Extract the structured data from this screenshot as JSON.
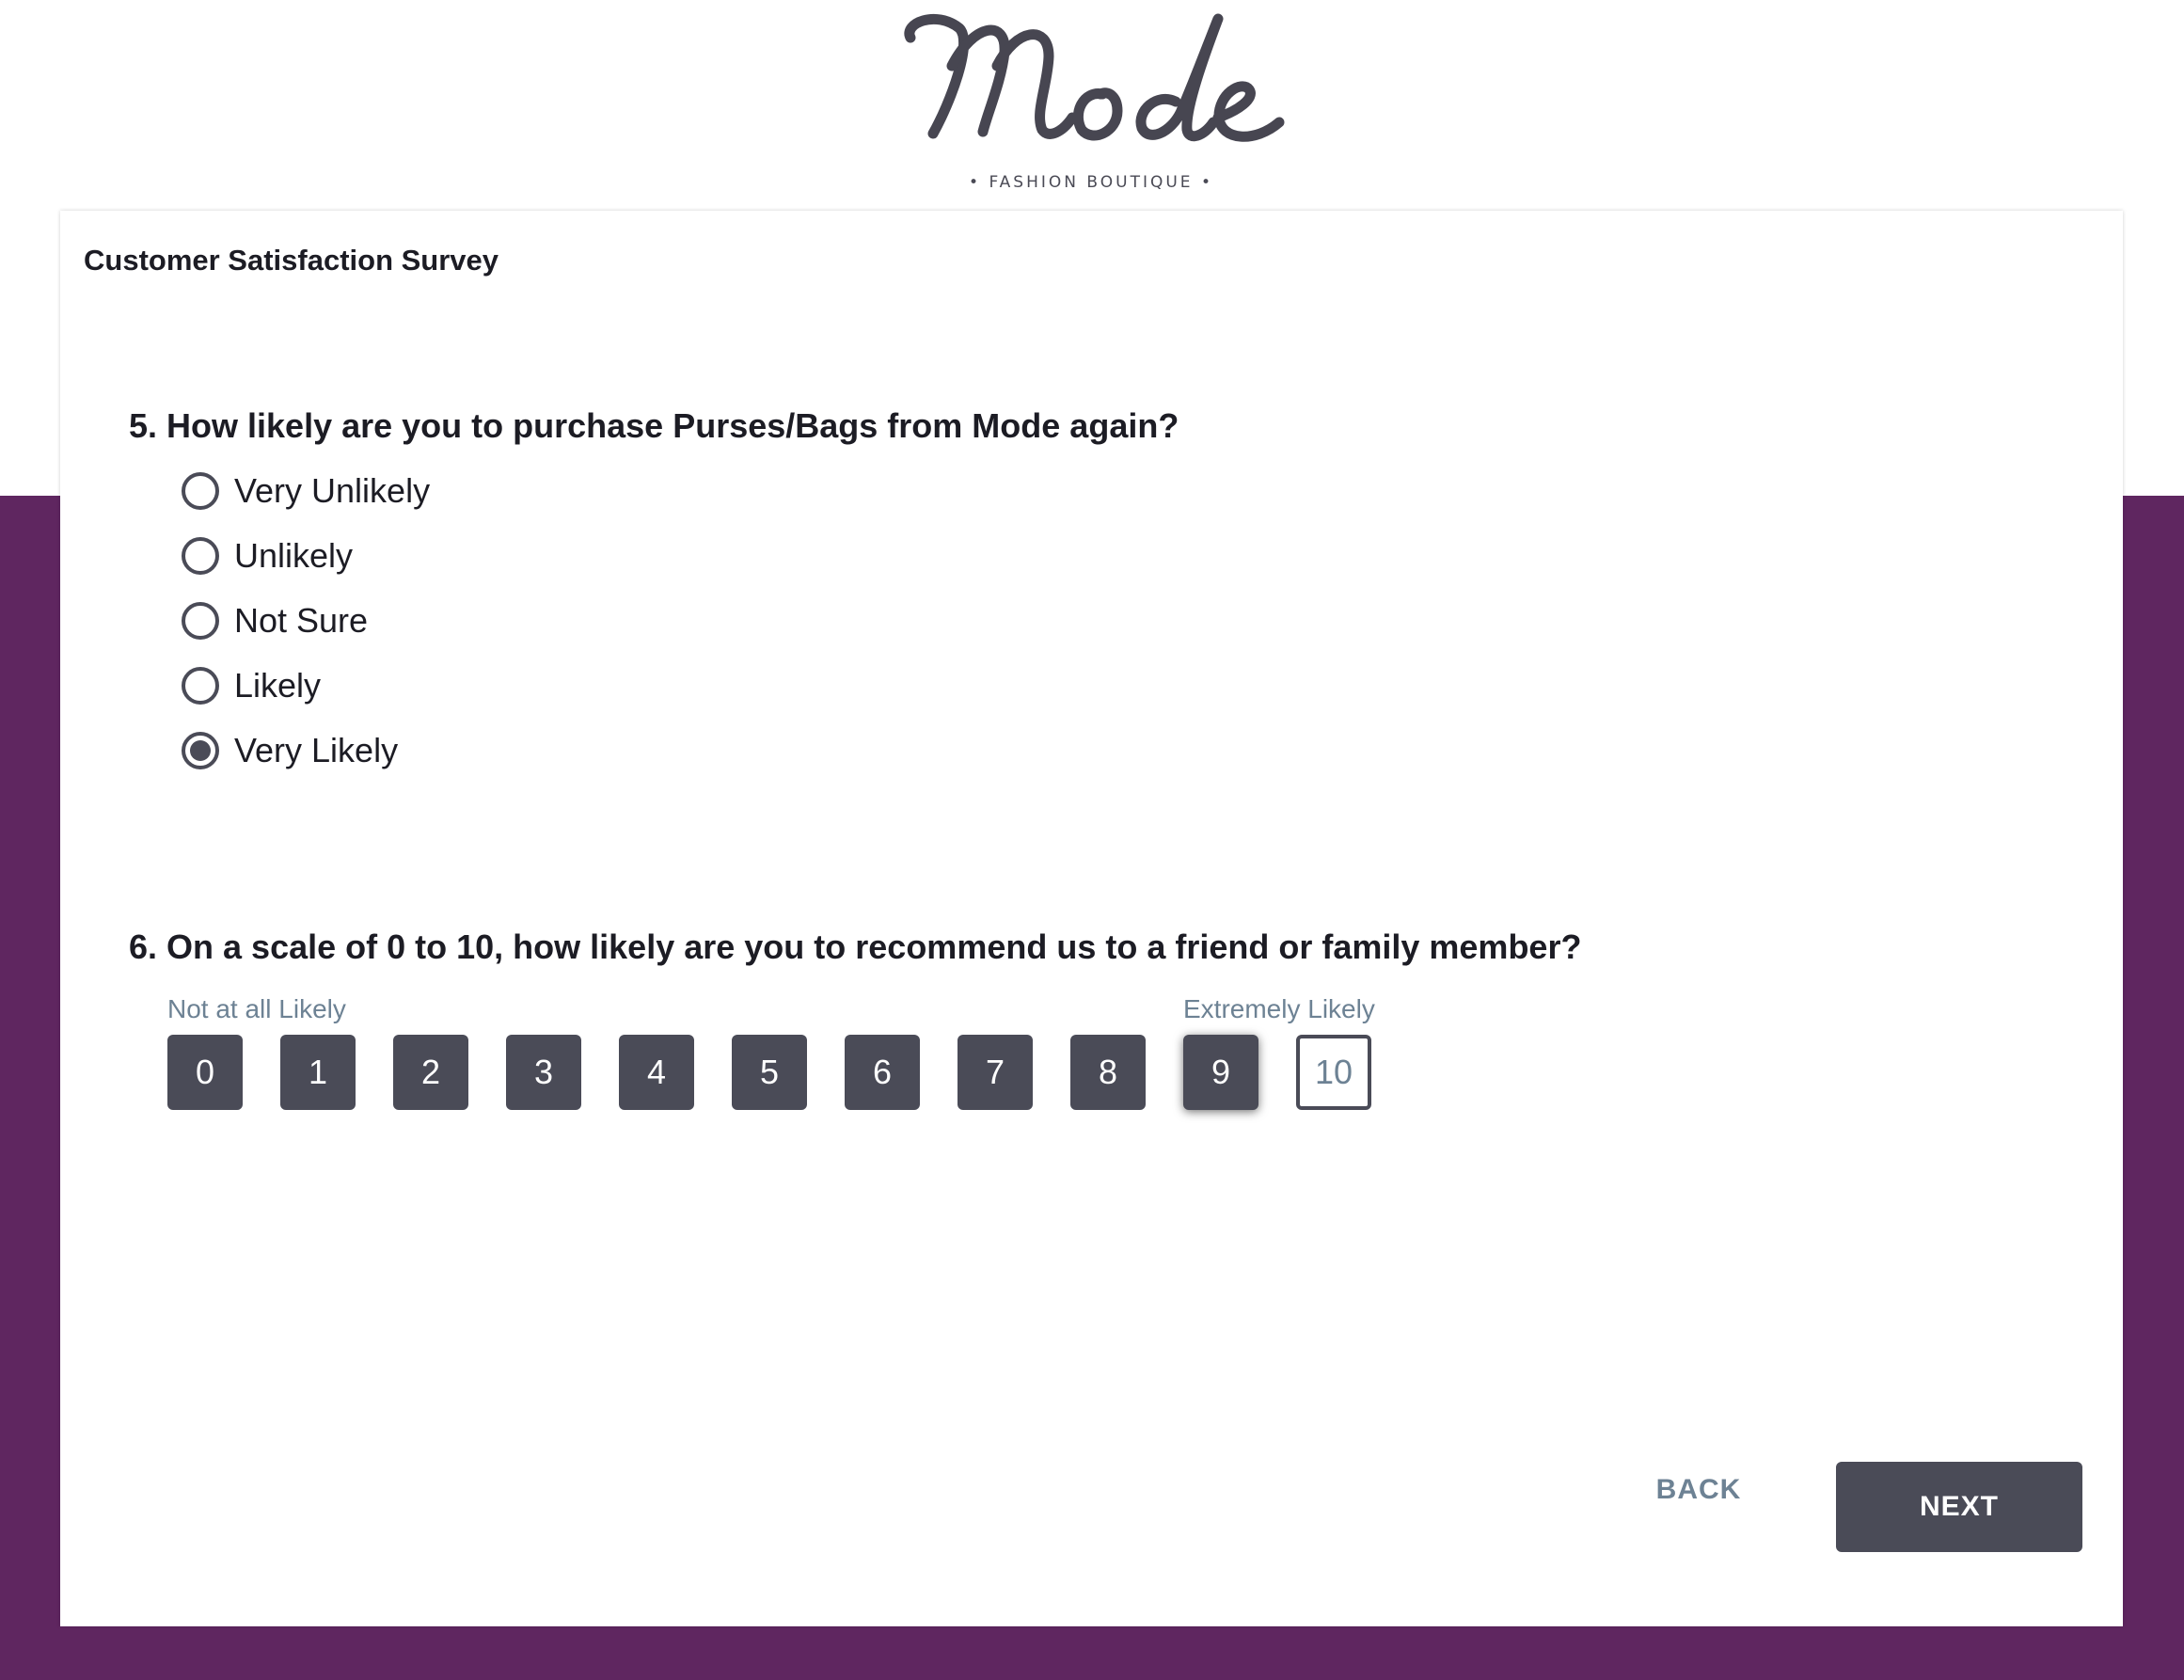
{
  "brand": {
    "logo_text": "Mode",
    "tagline": "• FASHION BOUTIQUE •",
    "primary_color": "#5f2660",
    "button_color": "#4a4b57",
    "muted_text_color": "#6d8294"
  },
  "survey": {
    "title": "Customer Satisfaction Survey"
  },
  "question5": {
    "text": "5. How likely are you to purchase Purses/Bags from Mode again?",
    "options": [
      {
        "label": "Very Unlikely",
        "selected": false
      },
      {
        "label": "Unlikely",
        "selected": false
      },
      {
        "label": "Not Sure",
        "selected": false
      },
      {
        "label": "Likely",
        "selected": false
      },
      {
        "label": "Very Likely",
        "selected": true
      }
    ]
  },
  "question6": {
    "text": "6. On a scale of 0 to 10, how likely are you to recommend us to a friend or family member?",
    "low_label": "Not at all Likely",
    "high_label": "Extremely Likely",
    "scale": [
      "0",
      "1",
      "2",
      "3",
      "4",
      "5",
      "6",
      "7",
      "8",
      "9",
      "10"
    ],
    "hovered": "9",
    "outlined": "10"
  },
  "nav": {
    "back_label": "BACK",
    "next_label": "NEXT"
  }
}
